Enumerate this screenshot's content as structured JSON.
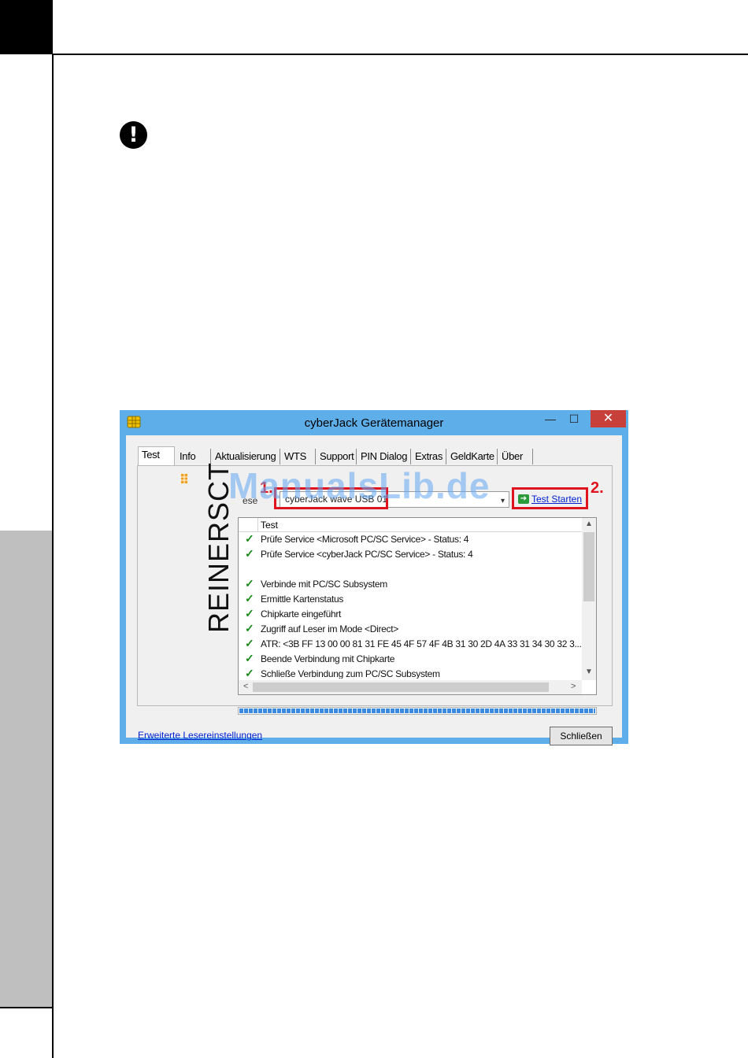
{
  "window": {
    "title": "cyberJack Gerätemanager",
    "controls": {
      "minimize": "—",
      "maximize": "☐",
      "close": "✕"
    }
  },
  "tabs": [
    "Test",
    "Info",
    "Aktualisierung",
    "WTS",
    "Support",
    "PIN Dialog",
    "Extras",
    "GeldKarte",
    "Über"
  ],
  "active_tab": "Test",
  "logo": {
    "text": "REINERSCT"
  },
  "reader": {
    "label": "ese",
    "value": "cyberJack wave USB 01"
  },
  "annotations": {
    "step1": "1.",
    "step2": "2."
  },
  "test_button": {
    "label": "Test Starten",
    "icon": "arrow-right-icon"
  },
  "list": {
    "column_header": "Test",
    "rows": [
      {
        "check": "✓",
        "text": "Prüfe Service <Microsoft PC/SC Service> - Status: 4"
      },
      {
        "check": "✓",
        "text": "Prüfe Service <cyberJack PC/SC Service> - Status: 4"
      },
      {
        "check": "",
        "text": ""
      },
      {
        "check": "✓",
        "text": "Verbinde mit PC/SC Subsystem"
      },
      {
        "check": "✓",
        "text": "Ermittle Kartenstatus"
      },
      {
        "check": "✓",
        "text": "Chipkarte eingeführt"
      },
      {
        "check": "✓",
        "text": "Zugriff auf Leser im Mode <Direct>"
      },
      {
        "check": "✓",
        "text": "ATR: <3B FF 13 00 00 81 31 FE 45 4F 57 4F 4B 31 30 2D 4A 33 31 34 30 32 3..."
      },
      {
        "check": "✓",
        "text": "Beende Verbindung mit Chipkarte"
      },
      {
        "check": "✓",
        "text": "Schließe Verbindung zum PC/SC Subsystem"
      }
    ],
    "scroll": {
      "up": "▲",
      "down": "▼",
      "left": "<",
      "right": ">"
    }
  },
  "progress": {
    "value": 1.0,
    "color": "#3c8ae0"
  },
  "bottom": {
    "advanced_link": "Erweiterte Lesereinstellungen",
    "close_button": "Schließen"
  },
  "page": {
    "warning_symbol": "!"
  },
  "watermark": "ManualsLib.de",
  "colors": {
    "window_frame": "#5eaeea",
    "close_button": "#c7403a",
    "highlight_red": "#e0141e",
    "link_blue": "#0020d0"
  }
}
